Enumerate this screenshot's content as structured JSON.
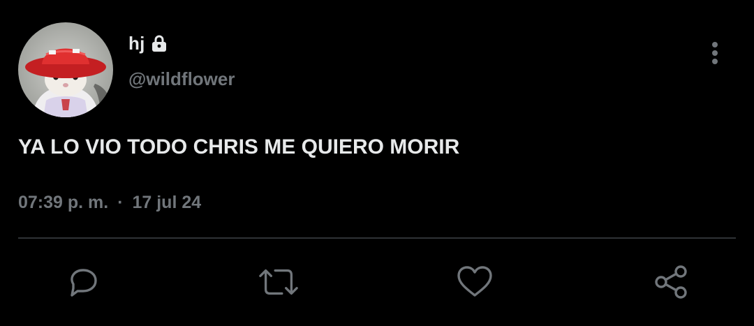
{
  "tweet": {
    "author": {
      "display_name": "hj",
      "handle": "@wildflower",
      "protected_icon": "lock-icon",
      "avatar_icon": "hamster-in-red-hat-avatar"
    },
    "text": "YA LO VIO TODO CHRIS ME QUIERO MORIR",
    "time": "07:39 p. m.",
    "separator": "·",
    "date": "17 jul 24",
    "menu_icon": "more-vertical-icon"
  },
  "actions": [
    {
      "name": "reply",
      "icon": "reply-icon"
    },
    {
      "name": "retweet",
      "icon": "retweet-icon"
    },
    {
      "name": "like",
      "icon": "heart-icon"
    },
    {
      "name": "share",
      "icon": "share-icon"
    }
  ],
  "colors": {
    "background": "#000000",
    "primary_text": "#e7e9ea",
    "secondary_text": "#71767b",
    "divider": "#2f3336",
    "avatar_hat": "#d42a2a"
  }
}
